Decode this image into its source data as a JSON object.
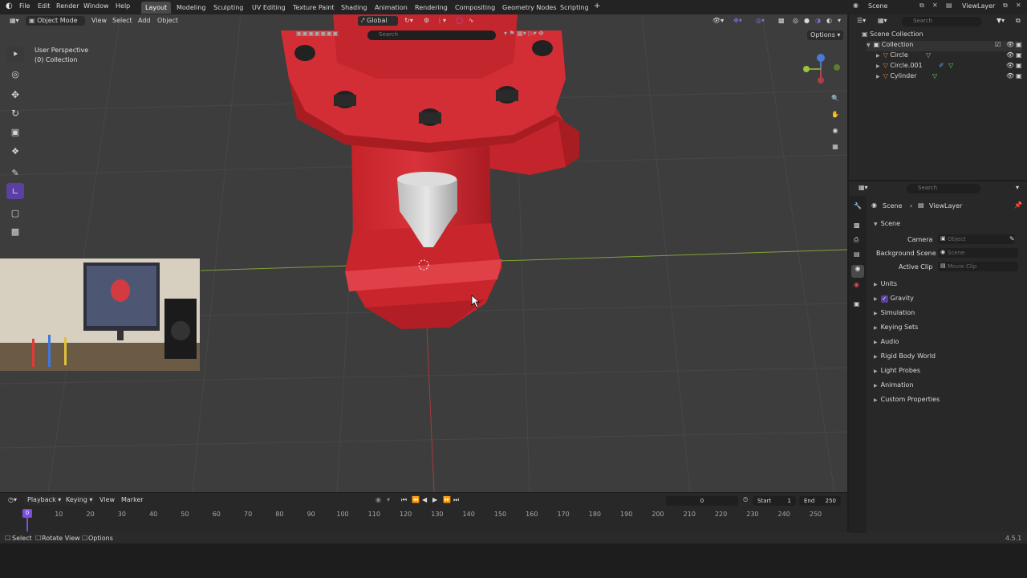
{
  "menu": {
    "file": "File",
    "edit": "Edit",
    "render": "Render",
    "window": "Window",
    "help": "Help"
  },
  "workspaces": [
    "Layout",
    "Modeling",
    "Sculpting",
    "UV Editing",
    "Texture Paint",
    "Shading",
    "Animation",
    "Rendering",
    "Compositing",
    "Geometry Nodes",
    "Scripting"
  ],
  "top_right": {
    "scene": "Scene",
    "view_layer": "ViewLayer"
  },
  "viewport": {
    "mode": "Object Mode",
    "view_menu": "View",
    "select_menu": "Select",
    "add_menu": "Add",
    "object_menu": "Object",
    "orientation": "Global",
    "search_placeholder": "Search",
    "options": "Options",
    "overlay_title": "User Perspective",
    "overlay_collection": "(0) Collection"
  },
  "outliner": {
    "search_placeholder": "Search",
    "scene_collection": "Scene Collection",
    "collection": "Collection",
    "items": [
      "Circle",
      "Circle.001",
      "Cylinder"
    ]
  },
  "properties": {
    "search_placeholder": "Search",
    "breadcrumb_scene": "Scene",
    "breadcrumb_viewlayer": "ViewLayer",
    "section_scene": "Scene",
    "camera_label": "Camera",
    "camera_placeholder": "Object",
    "background_label": "Background Scene",
    "background_placeholder": "Scene",
    "clip_label": "Active Clip",
    "clip_placeholder": "Movie Clip",
    "sections": [
      "Units",
      "Gravity",
      "Simulation",
      "Keying Sets",
      "Audio",
      "Rigid Body World",
      "Light Probes",
      "Animation",
      "Custom Properties"
    ],
    "gravity_checked": true
  },
  "timeline": {
    "playback": "Playback",
    "keying": "Keying",
    "view": "View",
    "marker": "Marker",
    "current_frame": "0",
    "start_label": "Start",
    "start_value": "1",
    "end_label": "End",
    "end_value": "250",
    "ticks": [
      "0",
      "10",
      "20",
      "30",
      "40",
      "50",
      "60",
      "70",
      "80",
      "90",
      "100",
      "110",
      "120",
      "130",
      "140",
      "150",
      "160",
      "170",
      "180",
      "190",
      "200",
      "210",
      "220",
      "230",
      "240",
      "250"
    ]
  },
  "statusbar": {
    "select": "Select",
    "rotate": "Rotate View",
    "options": "Options",
    "version": "4.5.1"
  },
  "colors": {
    "accent": "#5c3fa5",
    "active_tab": "#4a4a4a",
    "hydrant_red": "#d42b31",
    "playhead": "#7a4fe0"
  },
  "icons": {
    "blender_logo": "blender-logo-icon",
    "select_tool": "select-box-icon",
    "cursor_tool": "cursor-icon",
    "move_tool": "move-icon",
    "rotate_tool": "rotate-icon",
    "scale_tool": "scale-icon",
    "transform_tool": "transform-icon",
    "annotate_tool": "annotate-icon",
    "measure_tool": "measure-icon",
    "add_cube_tool": "add-cube-icon",
    "zoom": "zoom-icon",
    "pan": "hand-icon",
    "camera_view": "camera-icon",
    "grid_view": "grid-icon"
  }
}
